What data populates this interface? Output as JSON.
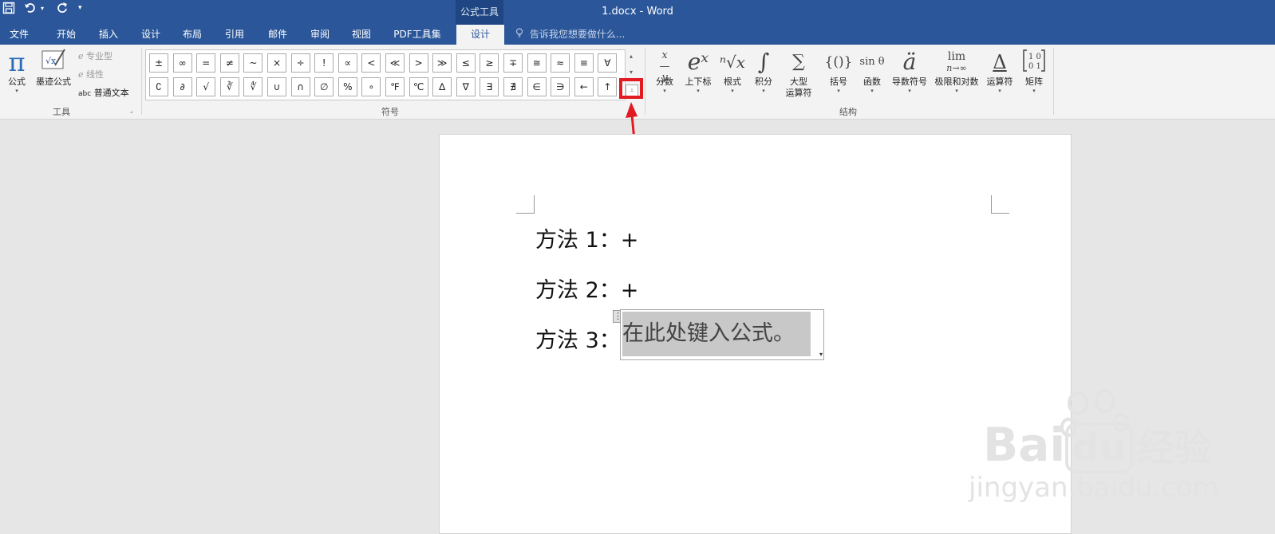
{
  "window": {
    "title": "1.docx - Word",
    "contextual_tab_group": "公式工具"
  },
  "quick_access": {
    "save_icon": "save-icon",
    "undo_icon": "undo-icon",
    "redo_icon": "redo-icon",
    "customize_icon": "customize-qat-icon"
  },
  "tabs": [
    {
      "label": "文件"
    },
    {
      "label": "开始"
    },
    {
      "label": "插入"
    },
    {
      "label": "设计"
    },
    {
      "label": "布局"
    },
    {
      "label": "引用"
    },
    {
      "label": "邮件"
    },
    {
      "label": "审阅"
    },
    {
      "label": "视图"
    },
    {
      "label": "PDF工具集"
    },
    {
      "label": "设计",
      "active": true
    }
  ],
  "tell_me": "告诉我您想要做什么...",
  "ribbon": {
    "tools_group": {
      "label": "工具",
      "equation_label": "公式",
      "ink_label": "墨迹公式",
      "professional_label": "专业型",
      "linear_label": "线性",
      "normal_text_label": "普通文本",
      "normal_text_prefix": "abc"
    },
    "symbols_group": {
      "label": "符号",
      "row1": [
        "±",
        "∞",
        "=",
        "≠",
        "~",
        "×",
        "÷",
        "!",
        "∝",
        "<",
        "≪",
        ">",
        "≫",
        "≤",
        "≥",
        "∓",
        "≅",
        "≈",
        "≡",
        "∀"
      ],
      "row2": [
        "∁",
        "∂",
        "√",
        "∛",
        "∜",
        "∪",
        "∩",
        "∅",
        "%",
        "∘",
        "℉",
        "℃",
        "∆",
        "∇",
        "∃",
        "∄",
        "∈",
        "∋",
        "←",
        "↑"
      ]
    },
    "structures_group": {
      "label": "结构",
      "items": [
        {
          "label": "分数",
          "symbol": "x/y"
        },
        {
          "label": "上下标",
          "symbol": "eˣ"
        },
        {
          "label": "根式",
          "symbol": "ⁿ√x"
        },
        {
          "label": "积分",
          "symbol": "∫"
        },
        {
          "label": "大型\n运算符",
          "symbol": "∑"
        },
        {
          "label": "括号",
          "symbol": "{()}"
        },
        {
          "label": "函数",
          "symbol": "sin θ"
        },
        {
          "label": "导数符号",
          "symbol": "ä"
        },
        {
          "label": "极限和对数",
          "symbol": "lim"
        },
        {
          "label": "运算符",
          "symbol": "Δ"
        },
        {
          "label": "矩阵",
          "symbol": "[10 01]"
        }
      ]
    }
  },
  "document": {
    "lines": [
      {
        "label": "方法 1：",
        "content": "+"
      },
      {
        "label": "方法 2：",
        "content": "+"
      },
      {
        "label": "方法 3：",
        "content": ""
      }
    ],
    "equation_placeholder": "在此处键入公式。"
  },
  "annotation": {
    "color": "#e21b23"
  },
  "watermark": {
    "brand_text": "Bai",
    "brand_text2": "du",
    "chinese": "经验",
    "url": "jingyan.baidu.com"
  }
}
